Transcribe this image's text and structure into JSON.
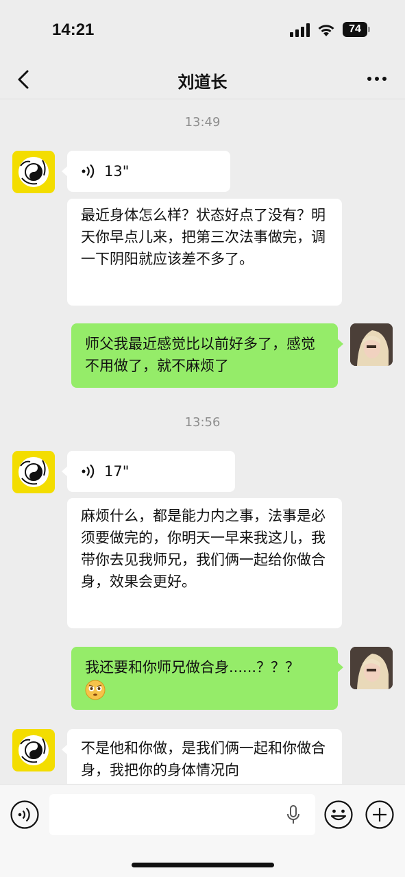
{
  "status_bar": {
    "time": "14:21",
    "battery": "74"
  },
  "header": {
    "title": "刘道长"
  },
  "messages": [
    {
      "type": "timestamp",
      "text": "13:49"
    },
    {
      "type": "voice",
      "side": "left",
      "duration": "13\""
    },
    {
      "type": "text",
      "side": "left",
      "text": "最近身体怎么样？状态好点了没有？明天你早点儿来，把第三次法事做完，调一下阴阳就应该差不多了。"
    },
    {
      "type": "text",
      "side": "right",
      "text": "师父我最近感觉比以前好多了，感觉不用做了，就不麻烦了"
    },
    {
      "type": "timestamp",
      "text": "13:56"
    },
    {
      "type": "voice",
      "side": "left",
      "duration": "17\""
    },
    {
      "type": "text",
      "side": "left",
      "text": "麻烦什么，都是能力内之事，法事是必须要做完的，你明天一早来我这儿，我带你去见我师兄，我们俩一起给你做合身，效果会更好。"
    },
    {
      "type": "text",
      "side": "right",
      "text": "我还要和你师兄做合身......？？？",
      "emoji": "flushed-face-emoji"
    },
    {
      "type": "text",
      "side": "left",
      "text": "不是他和你做，是我们俩一起和你做合身，我把你的身体情况向"
    }
  ],
  "input_bar": {
    "voice_button": "voice-toggle-icon",
    "emoji_button": "smiley-icon",
    "plus_button": "plus-icon",
    "mic": "microphone-icon"
  },
  "colors": {
    "background": "#ededed",
    "outgoing": "#95ec69",
    "incoming": "#ffffff",
    "avatar_left_bg": "#f3dd00"
  }
}
